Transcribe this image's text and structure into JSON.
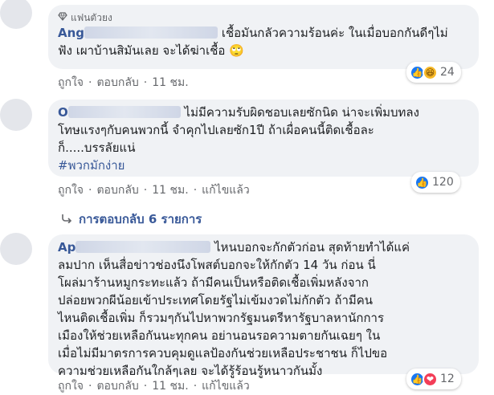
{
  "comments": [
    {
      "badge": "แฟนตัวยง",
      "name": "Ang",
      "text_line1": "เชื้อมันกลัวความร้อนค่ะ ในเมื่อบอกกันดีๆไม่",
      "text_line2": "ฟัง เผาบ้านสิมันเลย จะได้ฆ่าเชื้อ 🙄",
      "like": "ถูกใจ",
      "reply": "ตอบกลับ",
      "time": "11 ชม.",
      "reaction_count": "24"
    },
    {
      "name": "O",
      "text_line1": "ไม่มีความรับผิดชอบเลยซักนิด น่าจะเพิ่มบทลง",
      "text_line2": "โทษแรงๆกับคนพวกนี้ จำคุกไปเลยซัก1ปี ถ้าเผื่อคนนี้ติดเชื้อละ",
      "text_line3": "ก็.....บรรลัยแน่",
      "hashtag": "#พวกมักง่าย",
      "like": "ถูกใจ",
      "reply": "ตอบกลับ",
      "time": "11 ชม.",
      "edited": "แก้ไขแล้ว",
      "reaction_count": "120",
      "replies_label": "การตอบกลับ 6 รายการ"
    },
    {
      "name": "Ap",
      "text_line1": "ไหนบอกจะกักตัวก่อน สุดท้ายทำได้แค่",
      "text_line2": "ลมปาก เห็นสื่อข่าวช่องนึงโพสต์บอกจะให้กักตัว 14 วัน ก่อน นี่",
      "text_line3": "โผล่มาร้านหมูกระทะแล้ว ถ้ามีคนเป็นหรือติดเชื้อเพิ่มหลังจาก",
      "text_line4": "ปล่อยพวกผีน้อยเข้าประเทศโดยรัฐไม่เข้มงวดไม่กักตัว ถ้ามีคน",
      "text_line5": "ไหนติดเชื้อเพิ่ม ก็รวมๆกันไปหาพวกรัฐมนตรีหารัฐบาลหานักการ",
      "text_line6": "เมืองให้ช่วยเหลือกันนะทุกคน อย่านอนรอความตายกันเฉยๆ ใน",
      "text_line7": "เมื่อไม่มีมาตรการควบคุมดูแลป้องกันช่วยเหลือประชาชน ก็ไปขอ",
      "text_line8": "ความช่วยเหลือกันใกล้ๆเลย จะได้รู้ร้อนรู้หนาวกันมั้ง",
      "like": "ถูกใจ",
      "reply": "ตอบกลับ",
      "time": "11 ชม.",
      "edited": "แก้ไขแล้ว",
      "reaction_count": "12"
    }
  ],
  "colors": {
    "link": "#385898",
    "meta": "#65676b",
    "bubble": "#f0f2f5",
    "like_blue": "#1877f2"
  }
}
